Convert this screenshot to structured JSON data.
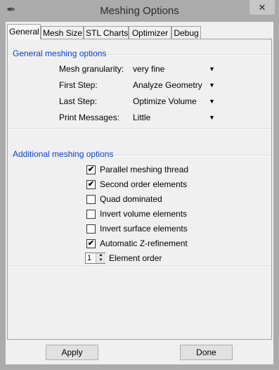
{
  "window": {
    "title": "Meshing Options",
    "close": "✕",
    "app_icon": "feather-icon"
  },
  "tabs": [
    {
      "label": "General"
    },
    {
      "label": "Mesh Size"
    },
    {
      "label": "STL Charts"
    },
    {
      "label": "Optimizer"
    },
    {
      "label": "Debug"
    }
  ],
  "general_group": {
    "title": "General meshing options",
    "rows": [
      {
        "label": "Mesh granularity:",
        "value": "very fine"
      },
      {
        "label": "First Step:",
        "value": "Analyze Geometry"
      },
      {
        "label": "Last Step:",
        "value": "Optimize Volume"
      },
      {
        "label": "Print Messages:",
        "value": "Little"
      }
    ],
    "dropdown_arrow": "▼"
  },
  "additional_group": {
    "title": "Additional meshing options",
    "options": [
      {
        "label": "Parallel meshing thread",
        "checked": "✔"
      },
      {
        "label": "Second order elements",
        "checked": "✔"
      },
      {
        "label": "Quad dominated",
        "checked": ""
      },
      {
        "label": "Invert volume elements",
        "checked": ""
      },
      {
        "label": "Invert surface elements",
        "checked": ""
      },
      {
        "label": "Automatic Z-refinement",
        "checked": "✔"
      }
    ],
    "element_order": {
      "value": "1",
      "label": "Element order",
      "up": "▲",
      "down": "▼"
    }
  },
  "buttons": {
    "apply": "Apply",
    "done": "Done"
  }
}
